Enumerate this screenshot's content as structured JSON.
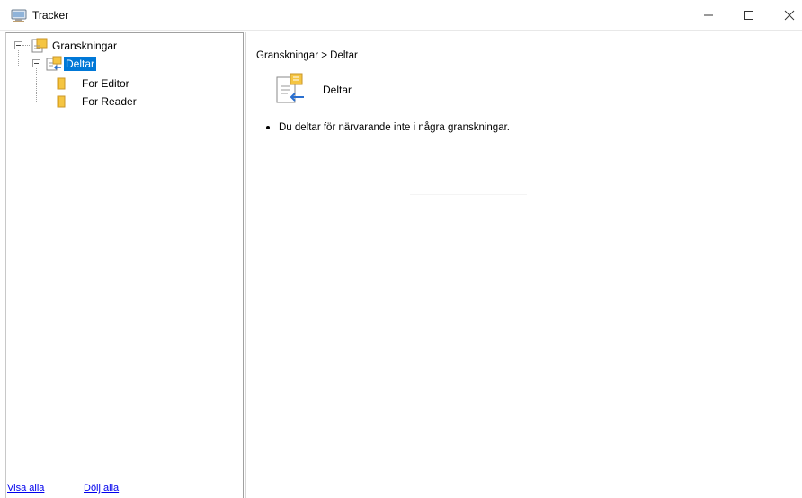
{
  "window": {
    "title": "Tracker",
    "controls": {
      "minimize": "—",
      "maximize": "☐",
      "close": "✕"
    }
  },
  "tree": {
    "root": {
      "label": "Granskningar",
      "icon": "review-folder-icon"
    },
    "child": {
      "label": "Deltar",
      "icon": "participate-icon",
      "selected": true
    },
    "leaves": [
      {
        "label": "For Editor",
        "icon": "yellow-folder-icon"
      },
      {
        "label": "For Reader",
        "icon": "yellow-folder-icon"
      }
    ]
  },
  "footer": {
    "show_all": "Visa alla",
    "hide_all": "Dölj alla"
  },
  "content": {
    "breadcrumb": "Granskningar > Deltar",
    "title": "Deltar",
    "message": "Du deltar för närvarande inte i några granskningar."
  },
  "colors": {
    "selection": "#0078d7",
    "link": "#0000ee",
    "folder": "#f5c542"
  }
}
